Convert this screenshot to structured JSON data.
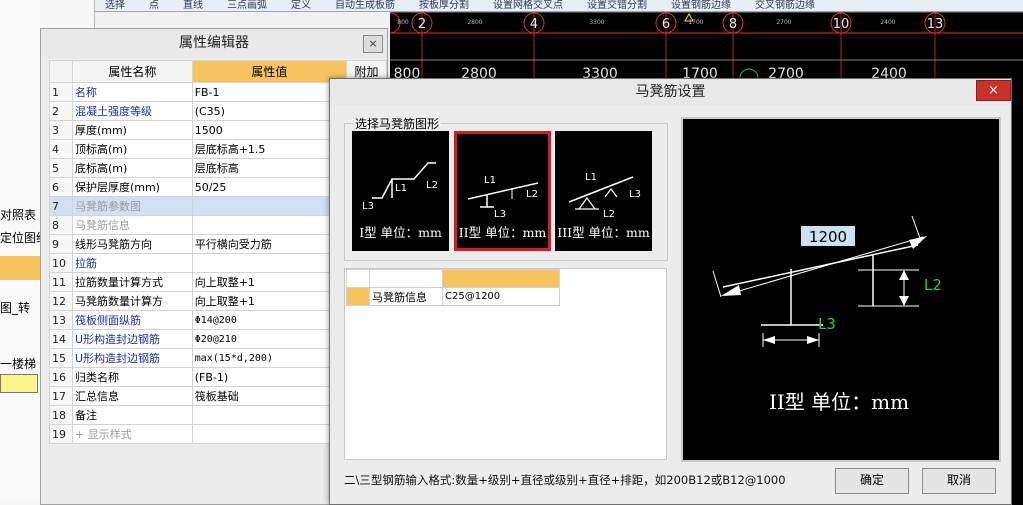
{
  "toolbar": {
    "items": [
      "选择",
      "点",
      "直线",
      "三点画弧",
      "定义",
      "自动生成板筋",
      "按板厚分割",
      "设置网格交叉点",
      "设置交错分割",
      "设置钢筋边缘",
      "交叉钢筋边缘"
    ]
  },
  "left_panel": {
    "items": [
      "对照表",
      "定位图纸",
      "图_转",
      "一楼梯"
    ]
  },
  "cad": {
    "axis_numbers": [
      "2",
      "4",
      "6",
      "8",
      "10",
      "13"
    ],
    "dims_top": [
      "800",
      "2800",
      "3300",
      "1700",
      "2700",
      "2400"
    ],
    "dims_large": [
      "800",
      "2800",
      "3300",
      "1700",
      "2700",
      "2400"
    ]
  },
  "property_editor": {
    "title": "属性编辑器",
    "close": "×",
    "columns": [
      "属性名称",
      "属性值",
      "附加"
    ],
    "rows": [
      {
        "no": "1",
        "name": "名称",
        "value": "FB-1",
        "style": "blue"
      },
      {
        "no": "2",
        "name": "混凝土强度等级",
        "value": "(C35)",
        "style": "blue"
      },
      {
        "no": "3",
        "name": "厚度(mm)",
        "value": "1500",
        "style": "black"
      },
      {
        "no": "4",
        "name": "顶标高(m)",
        "value": "层底标高+1.5",
        "style": "black"
      },
      {
        "no": "5",
        "name": "底标高(m)",
        "value": "层底标高",
        "style": "black"
      },
      {
        "no": "6",
        "name": "保护层厚度(mm)",
        "value": "50/25",
        "style": "black"
      },
      {
        "no": "7",
        "name": "马凳筋参数图",
        "value": "",
        "style": "gray"
      },
      {
        "no": "8",
        "name": "马凳筋信息",
        "value": "",
        "style": "gray"
      },
      {
        "no": "9",
        "name": "线形马凳筋方向",
        "value": "平行横向受力筋",
        "style": "black"
      },
      {
        "no": "10",
        "name": "拉筋",
        "value": "",
        "style": "blue"
      },
      {
        "no": "11",
        "name": "拉筋数量计算方式",
        "value": "向上取整+1",
        "style": "black"
      },
      {
        "no": "12",
        "name": "马凳筋数量计算方",
        "value": "向上取整+1",
        "style": "black"
      },
      {
        "no": "13",
        "name": "筏板侧面纵筋",
        "value": "Φ14@200",
        "style": "blue"
      },
      {
        "no": "14",
        "name": "U形构造封边钢筋",
        "value": "Φ20@210",
        "style": "blue"
      },
      {
        "no": "15",
        "name": "U形构造封边钢筋",
        "value": "max(15*d,200)",
        "style": "blue"
      },
      {
        "no": "16",
        "name": "归类名称",
        "value": "(FB-1)",
        "style": "black"
      },
      {
        "no": "17",
        "name": "汇总信息",
        "value": "筏板基础",
        "style": "black"
      },
      {
        "no": "18",
        "name": "备注",
        "value": "",
        "style": "black"
      },
      {
        "no": "19",
        "name": "+ 显示样式",
        "value": "",
        "style": "gray"
      }
    ],
    "selected_row": 6
  },
  "stool_dialog": {
    "title": "马凳筋设置",
    "close": "×",
    "group_label": "选择马凳筋图形",
    "shapes": [
      {
        "caption": "I型 单位：mm",
        "labels": [
          "L1",
          "L2",
          "L3"
        ]
      },
      {
        "caption": "II型 单位：mm",
        "labels": [
          "L1",
          "L2",
          "L3"
        ]
      },
      {
        "caption": "III型 单位：mm",
        "labels": [
          "L1",
          "L3",
          "L2"
        ]
      }
    ],
    "selected_shape": 1,
    "info_table": {
      "label": "马凳筋信息",
      "value": "C25@1200"
    },
    "preview": {
      "dim_value": "1200",
      "label_l2": "L2",
      "label_l3": "L3",
      "caption": "II型 单位：mm"
    },
    "hint": "二\\三型钢筋输入格式:数量+级别+直径或级别+直径+排距，如200B12或B12@1000",
    "ok_label": "确定",
    "cancel_label": "取消"
  },
  "colors": {
    "header_orange": "#f6c35f",
    "selected_row": "#cfe0f5",
    "cad_background": "#000000",
    "close_red": "#c9302c",
    "selected_shape_border": "#d51c1c",
    "cad_green": "#2ed12e",
    "cad_red_axis": "#e03030"
  }
}
